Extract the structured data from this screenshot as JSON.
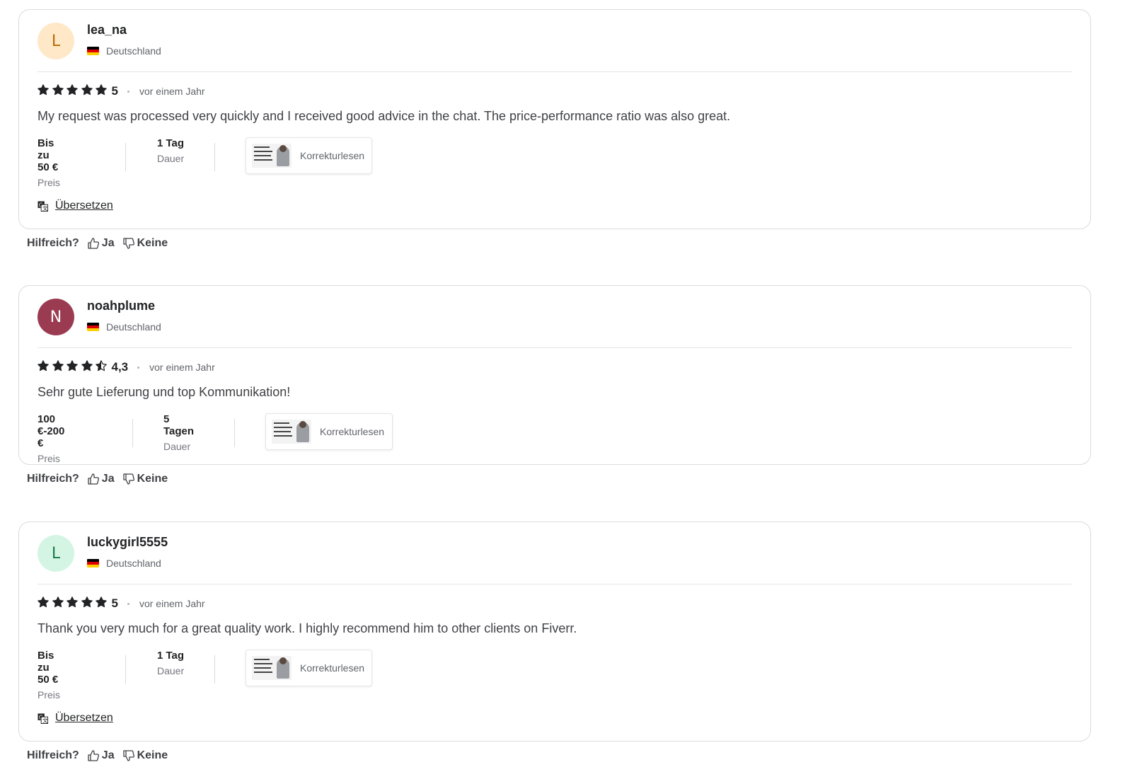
{
  "colors": {
    "star": "#222325",
    "star_empty": "#ffffff"
  },
  "reviews": [
    {
      "avatar_letter": "L",
      "avatar_bg": "#ffe8c8",
      "avatar_fg": "#b86a00",
      "username": "lea_na",
      "country": "Deutschland",
      "flag_icon": "germany-flag-icon",
      "rating": 5,
      "rating_label": "5",
      "time": "vor einem Jahr",
      "text": "My request was processed very quickly and I received good advice in the chat. The price-performance ratio was also great.",
      "price_value": "Bis zu 50 €",
      "price_label": "Preis",
      "duration_value": "1 Tag",
      "duration_label": "Dauer",
      "gig_label": "Korrekturlesen",
      "translate_label": "Übersetzen",
      "helpful_label": "Hilfreich?",
      "yes_label": "Ja",
      "no_label": "Keine"
    },
    {
      "avatar_letter": "N",
      "avatar_bg": "#9b3b52",
      "avatar_fg": "#ffffff",
      "username": "noahplume",
      "country": "Deutschland",
      "flag_icon": "germany-flag-icon",
      "rating": 4.3,
      "rating_label": "4,3",
      "time": "vor einem Jahr",
      "text": "Sehr gute Lieferung und top Kommunikation!",
      "price_value": "100 €-200 €",
      "price_label": "Preis",
      "duration_value": "5 Tagen",
      "duration_label": "Dauer",
      "gig_label": "Korrekturlesen",
      "helpful_label": "Hilfreich?",
      "yes_label": "Ja",
      "no_label": "Keine"
    },
    {
      "avatar_letter": "L",
      "avatar_bg": "#d4f5e4",
      "avatar_fg": "#1a7a45",
      "username": "luckygirl5555",
      "country": "Deutschland",
      "flag_icon": "germany-flag-icon",
      "rating": 5,
      "rating_label": "5",
      "time": "vor einem Jahr",
      "text": "Thank you very much for a great quality work. I highly recommend him to other clients on Fiverr.",
      "price_value": "Bis zu 50 €",
      "price_label": "Preis",
      "duration_value": "1 Tag",
      "duration_label": "Dauer",
      "gig_label": "Korrekturlesen",
      "translate_label": "Übersetzen",
      "helpful_label": "Hilfreich?",
      "yes_label": "Ja",
      "no_label": "Keine"
    }
  ]
}
